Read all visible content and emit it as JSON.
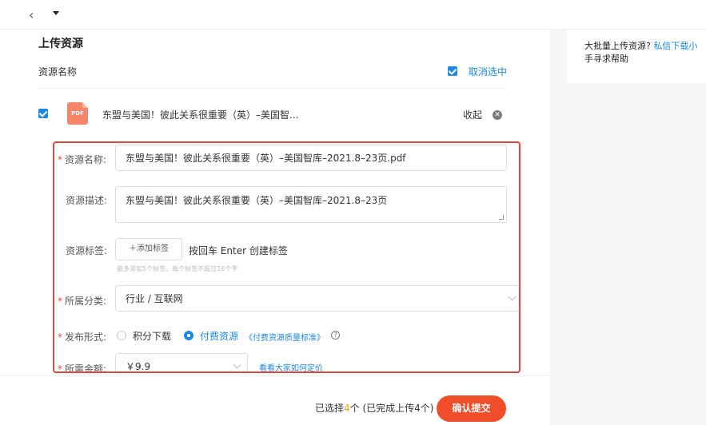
{
  "topbar": {
    "back_glyph": "‹"
  },
  "page": {
    "title": "上传资源"
  },
  "sidebar": {
    "text": "大批量上传资源? ",
    "link": "私信下载小",
    "text2": "手寻求帮助"
  },
  "list_header": {
    "label": "资源名称",
    "cancel_select": "取消选中"
  },
  "file": {
    "icon_text": "PDF",
    "name": "东盟与美国！彼此关系很重要（英）–美国智...",
    "collapse": "收起",
    "remove_glyph": "✕"
  },
  "form": {
    "name_label": "资源名称:",
    "name_value": "东盟与美国！彼此关系很重要（英）–美国智库–2021.8–23页.pdf",
    "desc_label": "资源描述:",
    "desc_value": "东盟与美国！彼此关系很重要（英）–美国智库–2021.8–23页",
    "tag_label": "资源标签:",
    "tag_button": "＋添加标签",
    "tag_hint": "按回车 Enter 创建标签",
    "tag_note": "最多添加5个标签，每个标签不超过16个字",
    "cat_label": "所属分类:",
    "cat_value": "行业 / 互联网",
    "form_label": "发布形式:",
    "opt_points": "积分下载",
    "opt_paid": "付费资源",
    "paid_link": "《付费资源质量标准》",
    "price_label": "所需金额:",
    "price_value": "￥9.9",
    "price_link": "看看大家如何定价"
  },
  "footer": {
    "summary_prefix": "已选择",
    "summary_count": "4",
    "summary_suffix": "个 (已完成上传4个)",
    "submit": "确认提交"
  },
  "colors": {
    "accent": "#1e88e5",
    "highlight_border": "#e8463b",
    "submit": "#f04e2b",
    "pdf_icon": "#f6866a"
  }
}
